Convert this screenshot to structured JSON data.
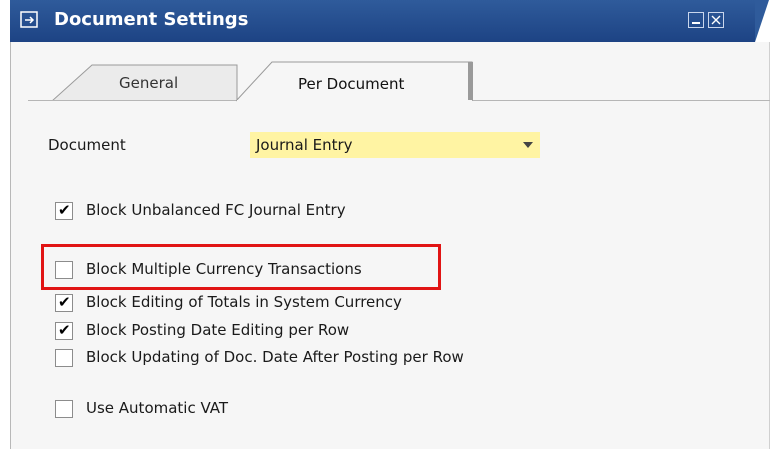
{
  "window": {
    "title": "Document Settings"
  },
  "tabs": [
    {
      "label": "General",
      "active": false
    },
    {
      "label": "Per Document",
      "active": true
    }
  ],
  "form": {
    "document_label": "Document",
    "document_value": "Journal Entry"
  },
  "checkboxes": [
    {
      "label": "Block Unbalanced FC Journal Entry",
      "checked": true
    },
    {
      "label": "Block Multiple Currency Transactions",
      "checked": false
    },
    {
      "label": "Block Editing of Totals in System Currency",
      "checked": true
    },
    {
      "label": "Block Posting Date Editing per Row",
      "checked": true
    },
    {
      "label": "Block Updating of Doc. Date After Posting per Row",
      "checked": false
    },
    {
      "label": "Use Automatic VAT",
      "checked": false
    }
  ],
  "colors": {
    "titlebar": "#1d4384",
    "field_highlight": "#fff4a3",
    "annotation": "#e11414"
  },
  "icons": [
    "window-icon",
    "minimize-icon",
    "close-icon",
    "dropdown-arrow-icon",
    "checkmark-icon"
  ]
}
